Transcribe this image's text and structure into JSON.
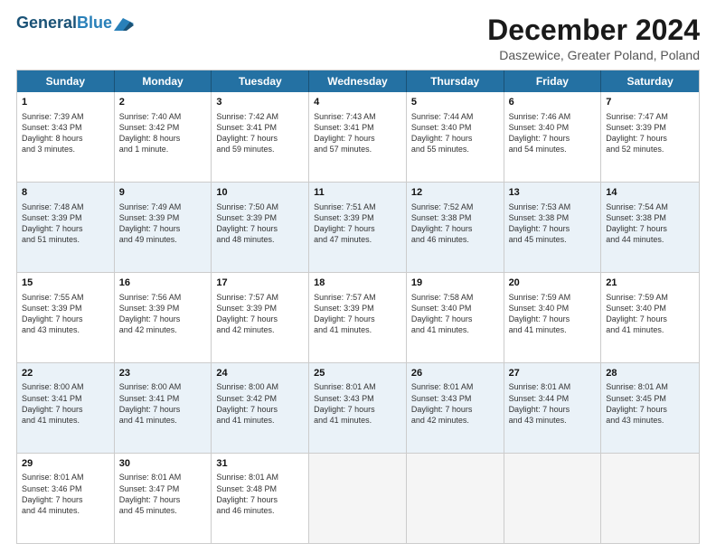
{
  "logo": {
    "line1": "General",
    "line2": "Blue"
  },
  "title": "December 2024",
  "subtitle": "Daszewice, Greater Poland, Poland",
  "header_days": [
    "Sunday",
    "Monday",
    "Tuesday",
    "Wednesday",
    "Thursday",
    "Friday",
    "Saturday"
  ],
  "rows": [
    [
      {
        "day": "1",
        "lines": [
          "Sunrise: 7:39 AM",
          "Sunset: 3:43 PM",
          "Daylight: 8 hours",
          "and 3 minutes."
        ]
      },
      {
        "day": "2",
        "lines": [
          "Sunrise: 7:40 AM",
          "Sunset: 3:42 PM",
          "Daylight: 8 hours",
          "and 1 minute."
        ]
      },
      {
        "day": "3",
        "lines": [
          "Sunrise: 7:42 AM",
          "Sunset: 3:41 PM",
          "Daylight: 7 hours",
          "and 59 minutes."
        ]
      },
      {
        "day": "4",
        "lines": [
          "Sunrise: 7:43 AM",
          "Sunset: 3:41 PM",
          "Daylight: 7 hours",
          "and 57 minutes."
        ]
      },
      {
        "day": "5",
        "lines": [
          "Sunrise: 7:44 AM",
          "Sunset: 3:40 PM",
          "Daylight: 7 hours",
          "and 55 minutes."
        ]
      },
      {
        "day": "6",
        "lines": [
          "Sunrise: 7:46 AM",
          "Sunset: 3:40 PM",
          "Daylight: 7 hours",
          "and 54 minutes."
        ]
      },
      {
        "day": "7",
        "lines": [
          "Sunrise: 7:47 AM",
          "Sunset: 3:39 PM",
          "Daylight: 7 hours",
          "and 52 minutes."
        ]
      }
    ],
    [
      {
        "day": "8",
        "lines": [
          "Sunrise: 7:48 AM",
          "Sunset: 3:39 PM",
          "Daylight: 7 hours",
          "and 51 minutes."
        ]
      },
      {
        "day": "9",
        "lines": [
          "Sunrise: 7:49 AM",
          "Sunset: 3:39 PM",
          "Daylight: 7 hours",
          "and 49 minutes."
        ]
      },
      {
        "day": "10",
        "lines": [
          "Sunrise: 7:50 AM",
          "Sunset: 3:39 PM",
          "Daylight: 7 hours",
          "and 48 minutes."
        ]
      },
      {
        "day": "11",
        "lines": [
          "Sunrise: 7:51 AM",
          "Sunset: 3:39 PM",
          "Daylight: 7 hours",
          "and 47 minutes."
        ]
      },
      {
        "day": "12",
        "lines": [
          "Sunrise: 7:52 AM",
          "Sunset: 3:38 PM",
          "Daylight: 7 hours",
          "and 46 minutes."
        ]
      },
      {
        "day": "13",
        "lines": [
          "Sunrise: 7:53 AM",
          "Sunset: 3:38 PM",
          "Daylight: 7 hours",
          "and 45 minutes."
        ]
      },
      {
        "day": "14",
        "lines": [
          "Sunrise: 7:54 AM",
          "Sunset: 3:38 PM",
          "Daylight: 7 hours",
          "and 44 minutes."
        ]
      }
    ],
    [
      {
        "day": "15",
        "lines": [
          "Sunrise: 7:55 AM",
          "Sunset: 3:39 PM",
          "Daylight: 7 hours",
          "and 43 minutes."
        ]
      },
      {
        "day": "16",
        "lines": [
          "Sunrise: 7:56 AM",
          "Sunset: 3:39 PM",
          "Daylight: 7 hours",
          "and 42 minutes."
        ]
      },
      {
        "day": "17",
        "lines": [
          "Sunrise: 7:57 AM",
          "Sunset: 3:39 PM",
          "Daylight: 7 hours",
          "and 42 minutes."
        ]
      },
      {
        "day": "18",
        "lines": [
          "Sunrise: 7:57 AM",
          "Sunset: 3:39 PM",
          "Daylight: 7 hours",
          "and 41 minutes."
        ]
      },
      {
        "day": "19",
        "lines": [
          "Sunrise: 7:58 AM",
          "Sunset: 3:40 PM",
          "Daylight: 7 hours",
          "and 41 minutes."
        ]
      },
      {
        "day": "20",
        "lines": [
          "Sunrise: 7:59 AM",
          "Sunset: 3:40 PM",
          "Daylight: 7 hours",
          "and 41 minutes."
        ]
      },
      {
        "day": "21",
        "lines": [
          "Sunrise: 7:59 AM",
          "Sunset: 3:40 PM",
          "Daylight: 7 hours",
          "and 41 minutes."
        ]
      }
    ],
    [
      {
        "day": "22",
        "lines": [
          "Sunrise: 8:00 AM",
          "Sunset: 3:41 PM",
          "Daylight: 7 hours",
          "and 41 minutes."
        ]
      },
      {
        "day": "23",
        "lines": [
          "Sunrise: 8:00 AM",
          "Sunset: 3:41 PM",
          "Daylight: 7 hours",
          "and 41 minutes."
        ]
      },
      {
        "day": "24",
        "lines": [
          "Sunrise: 8:00 AM",
          "Sunset: 3:42 PM",
          "Daylight: 7 hours",
          "and 41 minutes."
        ]
      },
      {
        "day": "25",
        "lines": [
          "Sunrise: 8:01 AM",
          "Sunset: 3:43 PM",
          "Daylight: 7 hours",
          "and 41 minutes."
        ]
      },
      {
        "day": "26",
        "lines": [
          "Sunrise: 8:01 AM",
          "Sunset: 3:43 PM",
          "Daylight: 7 hours",
          "and 42 minutes."
        ]
      },
      {
        "day": "27",
        "lines": [
          "Sunrise: 8:01 AM",
          "Sunset: 3:44 PM",
          "Daylight: 7 hours",
          "and 43 minutes."
        ]
      },
      {
        "day": "28",
        "lines": [
          "Sunrise: 8:01 AM",
          "Sunset: 3:45 PM",
          "Daylight: 7 hours",
          "and 43 minutes."
        ]
      }
    ],
    [
      {
        "day": "29",
        "lines": [
          "Sunrise: 8:01 AM",
          "Sunset: 3:46 PM",
          "Daylight: 7 hours",
          "and 44 minutes."
        ]
      },
      {
        "day": "30",
        "lines": [
          "Sunrise: 8:01 AM",
          "Sunset: 3:47 PM",
          "Daylight: 7 hours",
          "and 45 minutes."
        ]
      },
      {
        "day": "31",
        "lines": [
          "Sunrise: 8:01 AM",
          "Sunset: 3:48 PM",
          "Daylight: 7 hours",
          "and 46 minutes."
        ]
      },
      {
        "day": "",
        "lines": []
      },
      {
        "day": "",
        "lines": []
      },
      {
        "day": "",
        "lines": []
      },
      {
        "day": "",
        "lines": []
      }
    ]
  ]
}
